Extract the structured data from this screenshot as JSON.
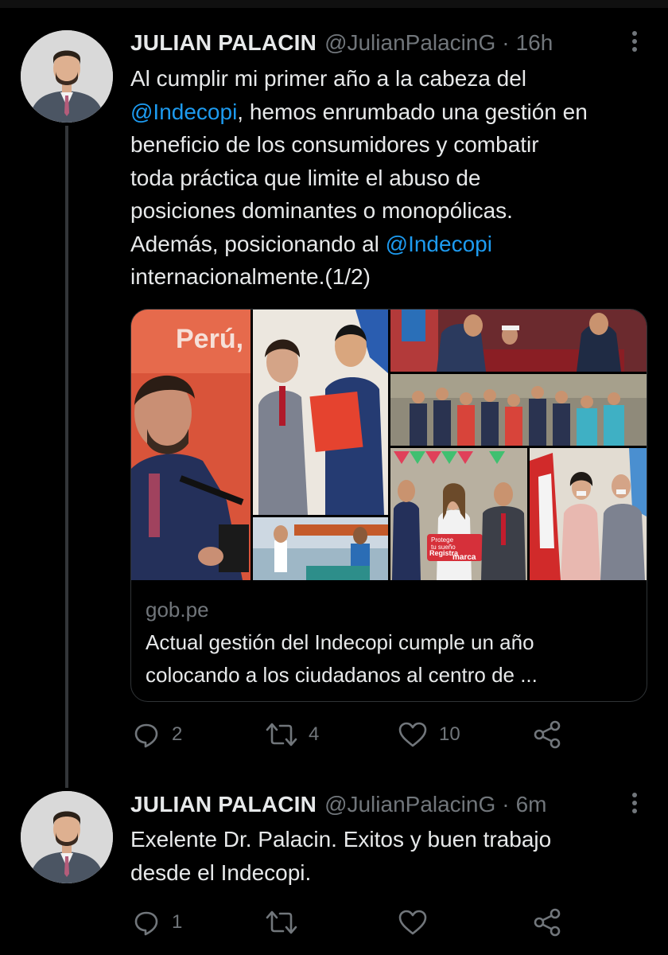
{
  "tweets": [
    {
      "author_name": "JULIAN PALACIN",
      "handle": "@JulianPalacinG",
      "separator": "·",
      "time": "16h",
      "text_lines": [
        [
          {
            "t": "Al cumplir mi primer año a la cabeza del"
          }
        ],
        [
          {
            "t": "@Indecopi",
            "m": true
          },
          {
            "t": ", hemos enrumbado una gestión en"
          }
        ],
        [
          {
            "t": "beneficio de los consumidores y combatir"
          }
        ],
        [
          {
            "t": "toda práctica que limite el abuso de"
          }
        ],
        [
          {
            "t": "posiciones dominantes o monopólicas."
          }
        ],
        [
          {
            "t": "Además, posicionando al "
          },
          {
            "t": "@Indecopi",
            "m": true
          }
        ],
        [
          {
            "t": "internacionalmente.(1/2)"
          }
        ]
      ],
      "card": {
        "domain": "gob.pe",
        "title": "Actual gestión del Indecopi cumple un año colocando a los ciudadanos al centro de ...",
        "image_texts": {
          "banner": "Perú,",
          "sign_line1": "Protege",
          "sign_line2": "tu sueño",
          "sign_line3": "Registra",
          "sign_line4": "marca"
        }
      },
      "actions": {
        "reply_count": "2",
        "retweet_count": "4",
        "like_count": "10",
        "share_count": ""
      }
    },
    {
      "author_name": "JULIAN PALACIN",
      "handle": "@JulianPalacinG",
      "separator": "·",
      "time": "6m",
      "text_lines": [
        [
          {
            "t": "Exelente Dr. Palacin. Exitos y buen trabajo"
          }
        ],
        [
          {
            "t": "desde el Indecopi."
          }
        ]
      ],
      "actions": {
        "reply_count": "1",
        "retweet_count": "",
        "like_count": "",
        "share_count": ""
      }
    }
  ],
  "icons": {
    "reply": "reply-icon",
    "retweet": "retweet-icon",
    "like": "like-icon",
    "share": "share-icon",
    "more": "more-options-icon"
  },
  "colors": {
    "background": "#000000",
    "text": "#e7e9ea",
    "secondary": "#71767b",
    "mention": "#1d9bf0",
    "thread_line": "#333639"
  }
}
